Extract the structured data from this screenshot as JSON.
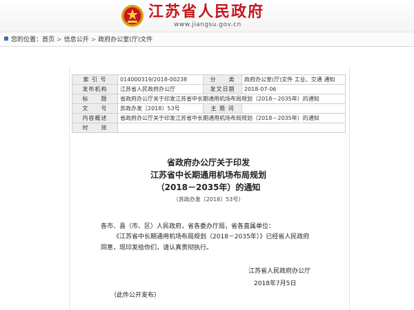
{
  "header": {
    "site_title": "江苏省人民政府",
    "site_url": "www.jiangsu.gov.cn"
  },
  "breadcrumb": {
    "prefix": "您的位置：",
    "items": [
      "首页",
      "信息公开",
      "政府办公室(厅)文件"
    ],
    "separator": ">"
  },
  "meta": {
    "index_label": "索 引 号",
    "index_value": "014000319/2018-00238",
    "category_label": "分　　类",
    "category_value": "政府办公室(厅)文件 工业、交通 通知",
    "issuer_label": "发布机构",
    "issuer_value": "江苏省人民政府办公厅",
    "date_label": "发文日期",
    "date_value": "2018-07-06",
    "title_label": "标　　题",
    "title_value": "省政府办公厅关于印发江苏省中长期通用机场布局规划（2018－2035年）的通知",
    "docno_label": "文　　号",
    "docno_value": "苏政办发〔2018〕53号",
    "subject_label": "主 题 词",
    "subject_value": "",
    "summary_label": "内容概述",
    "summary_value": "省政府办公厅关于印发江苏省中长期通用机场布局规划（2018－2035年）的通知",
    "timeliness_label": "时　　效",
    "timeliness_value": ""
  },
  "document": {
    "title_line1": "省政府办公厅关于印发",
    "title_line2": "江苏省中长期通用机场布局规划",
    "title_line3": "（2018－2035年）的通知",
    "doc_number": "（苏政办发〔2018〕53号）",
    "para1": "各市、县（市、区）人民政府，省各委办厅局，省各直属单位：",
    "para2": "《江苏省中长期通用机场布局规划（2018－2035年）》已经省人民政府",
    "para3": "同意，现印发给你们，请认真贯彻执行。",
    "signer": "江苏省人民政府办公厅",
    "sign_date": "2018年7月5日",
    "note": "（此件公开发布）"
  },
  "colors": {
    "brand_red": "#c8161d",
    "label_bg": "#ededed",
    "border": "#cfcfcf"
  }
}
